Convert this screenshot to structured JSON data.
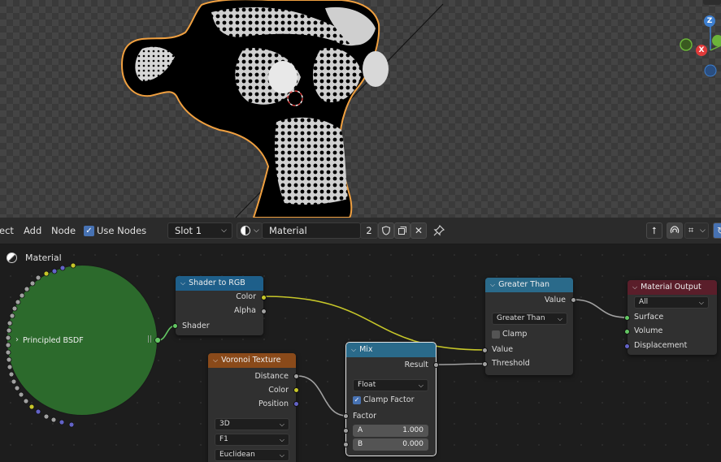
{
  "header": {
    "menu_select_partial": "ect",
    "menu_add": "Add",
    "menu_node": "Node",
    "use_nodes_label": "Use Nodes",
    "use_nodes_checked": true,
    "slot_value": "Slot 1",
    "material_name": "Material",
    "user_count": "2"
  },
  "breadcrumb": {
    "label": "Material"
  },
  "gizmo": {
    "z": "Z",
    "x": "X"
  },
  "nodes": {
    "principled": {
      "title": "Principled BSDF",
      "color": "#2a6a2a"
    },
    "shader_to_rgb": {
      "title": "Shader to RGB",
      "out_color": "Color",
      "out_alpha": "Alpha",
      "in_shader": "Shader"
    },
    "voronoi": {
      "title": "Voronoi Texture",
      "out_distance": "Distance",
      "out_color": "Color",
      "out_position": "Position",
      "dim": "3D",
      "feature": "F1",
      "metric": "Euclidean"
    },
    "mix": {
      "title": "Mix",
      "out_result": "Result",
      "data_type": "Float",
      "clamp_label": "Clamp Factor",
      "clamp_checked": true,
      "factor_label": "Factor",
      "a_label": "A",
      "a_value": "1.000",
      "b_label": "B",
      "b_value": "0.000"
    },
    "greater_than": {
      "title": "Greater Than",
      "out_value": "Value",
      "operation": "Greater Than",
      "clamp_label": "Clamp",
      "clamp_checked": false,
      "in_value": "Value",
      "in_threshold": "Threshold"
    },
    "material_output": {
      "title": "Material Output",
      "target": "All",
      "in_surface": "Surface",
      "in_volume": "Volume",
      "in_displacement": "Displacement"
    }
  },
  "colors": {
    "shader_header": "#1e5f8a",
    "texture_header": "#8a4a1a",
    "converter_header": "#2a6a8a",
    "output_header": "#5a1e2a",
    "link_yellow": "#c7c729",
    "link_gray": "#a1a1a1",
    "link_green": "#63c763",
    "selection_orange": "#f5a623"
  }
}
